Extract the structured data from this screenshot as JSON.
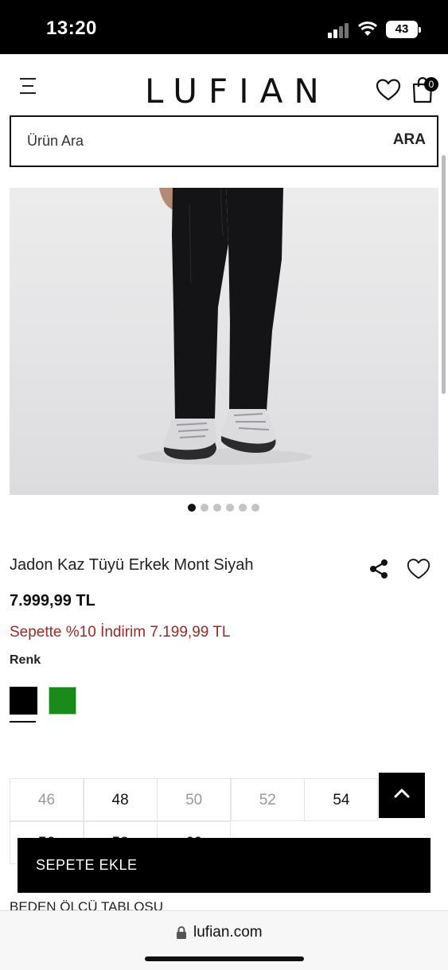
{
  "status_bar": {
    "time": "13:20",
    "battery": "43"
  },
  "header": {
    "logo": "LUFIAN",
    "cart_count": "0"
  },
  "search": {
    "placeholder": "Ürün Ara",
    "button_label": "ARA"
  },
  "carousel": {
    "total": 6,
    "active_index": 0
  },
  "product": {
    "title": "Jadon Kaz Tüyü Erkek Mont Siyah",
    "price": "7.999,99 TL",
    "discount_text": "Sepette %10 İndirim 7.199,99 TL",
    "color_label": "Renk",
    "colors": [
      {
        "name": "black",
        "hex": "#000000",
        "selected": true
      },
      {
        "name": "green",
        "hex": "#1a8a1a",
        "selected": false
      }
    ]
  },
  "sizes": [
    {
      "label": "46",
      "available": false
    },
    {
      "label": "48",
      "available": true
    },
    {
      "label": "50",
      "available": false
    },
    {
      "label": "52",
      "available": false
    },
    {
      "label": "54",
      "available": true
    },
    {
      "label": "56",
      "available": true
    },
    {
      "label": "58",
      "available": true
    },
    {
      "label": "60",
      "available": true
    }
  ],
  "actions": {
    "add_to_cart": "SEPETE EKLE",
    "size_chart": "BEDEN ÖLÇÜ TABLOSU"
  },
  "browser": {
    "url": "lufian.com"
  },
  "icons": {
    "menu": "hamburger-menu-icon",
    "wishlist": "heart-icon",
    "cart": "shopping-bag-icon",
    "share": "share-icon",
    "back_to_top": "chevron-up-icon",
    "lock": "lock-icon"
  }
}
